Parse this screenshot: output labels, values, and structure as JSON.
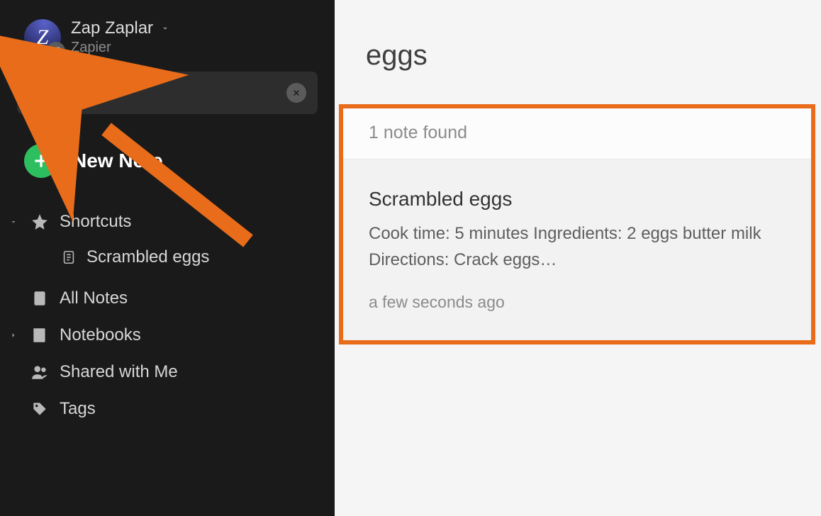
{
  "account": {
    "avatar_letter": "Z",
    "name": "Zap Zaplar",
    "org": "Zapier"
  },
  "search": {
    "value": "eggs"
  },
  "new_note_label": "New Note",
  "nav": {
    "shortcuts_label": "Shortcuts",
    "shortcut_items": [
      "Scrambled eggs"
    ],
    "all_notes_label": "All Notes",
    "notebooks_label": "Notebooks",
    "shared_label": "Shared with Me",
    "tags_label": "Tags"
  },
  "results": {
    "query_title": "eggs",
    "count_text": "1 note found",
    "items": [
      {
        "title": "Scrambled eggs",
        "snippet": "Cook time: 5 minutes Ingredients: 2 eggs butter milk Directions: Crack eggs…",
        "time": "a few seconds ago"
      }
    ]
  }
}
